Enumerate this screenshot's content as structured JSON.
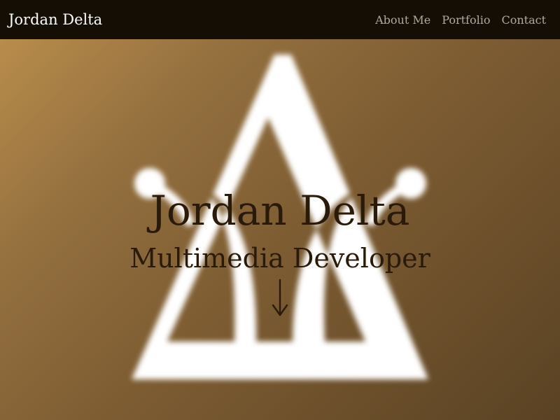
{
  "navbar": {
    "brand": "Jordan Delta",
    "links": [
      {
        "label": "About Me"
      },
      {
        "label": "Portfolio"
      },
      {
        "label": "Contact"
      }
    ]
  },
  "hero": {
    "title": "Jordan Delta",
    "subtitle": "Multimedia Developer",
    "scroll_icon": "arrow-down-icon",
    "logo_icon": "delta-logo-icon"
  },
  "colors": {
    "navbar_bg": "#150e05",
    "nav_link": "#b3a99c",
    "brand_text": "#ffffff",
    "hero_text": "#2a1a0a",
    "hero_gradient_start": "#b88c4b",
    "hero_gradient_end": "#594223",
    "logo": "#ffffff"
  }
}
